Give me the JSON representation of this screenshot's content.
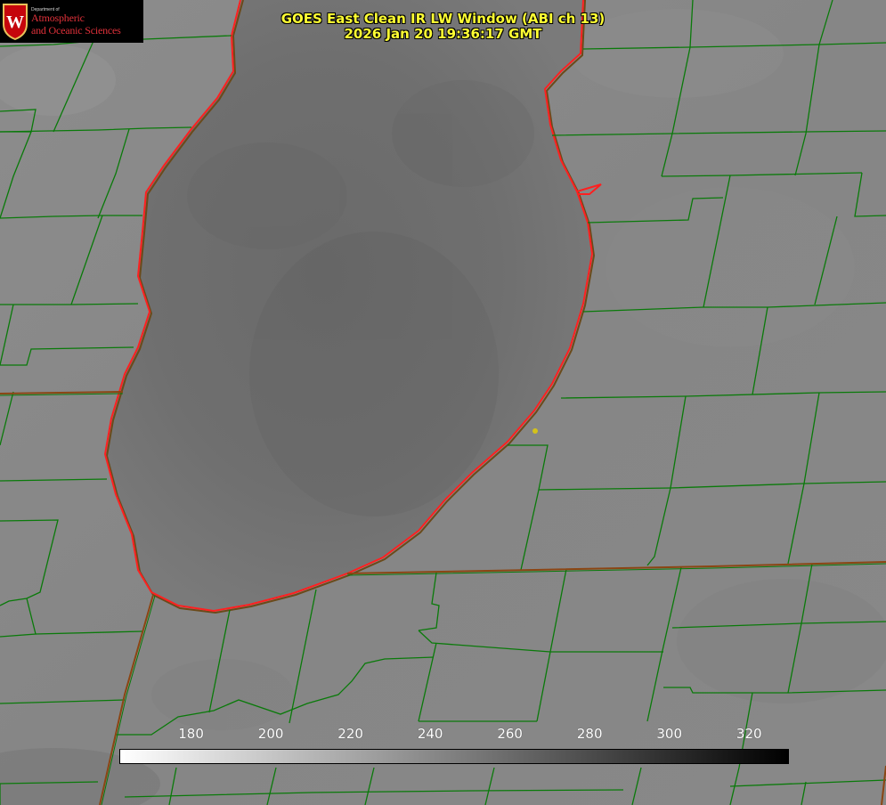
{
  "title": {
    "line1": "GOES East Clean IR LW Window (ABI ch 13)",
    "line2": "2026 Jan 20 19:36:17 GMT"
  },
  "logo": {
    "dept": "Department of",
    "line1": "Atmospheric",
    "line2": "and Oceanic Sciences",
    "crest_letter": "W"
  },
  "colorbar": {
    "ticks": [
      "180",
      "200",
      "220",
      "240",
      "260",
      "280",
      "300",
      "320"
    ],
    "min": 162,
    "max": 330,
    "gradient_from": "#ffffff",
    "gradient_to": "#000000"
  },
  "colors": {
    "shoreline": "#ff2020",
    "shoreline_alt": "#7a3a10",
    "county_lines": "#0a7a0a",
    "state_line": "#8b4513",
    "title_text": "#ffff33",
    "marker": "#d4c21a"
  }
}
